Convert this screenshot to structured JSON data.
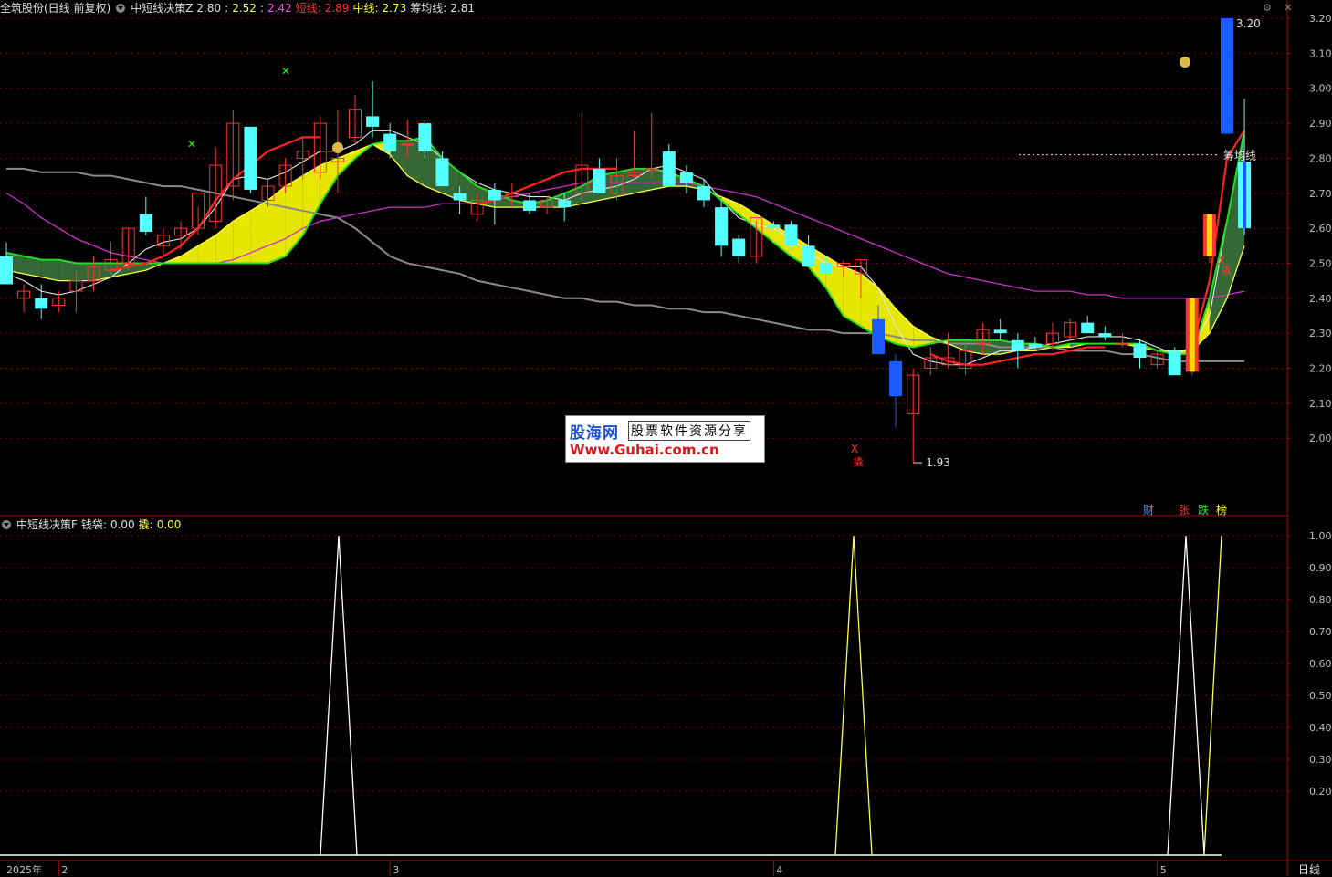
{
  "header": {
    "stock": "全筑股份(日线 前复权)",
    "indicator": "中短线决策Z",
    "v1": "2.80",
    "v2": "2.52",
    "v3": "2.42",
    "short_label": "短线:",
    "short_val": "2.89",
    "mid_label": "中线:",
    "mid_val": "2.73",
    "cost_label": "筹均线:",
    "cost_val": "2.81"
  },
  "sub_header": {
    "indicator": "中短线决策F",
    "bag_label": "钱袋:",
    "bag_val": "0.00",
    "sell_label": "撬:",
    "sell_val": "0.00"
  },
  "annotations": {
    "high": "3.20",
    "low": "1.93",
    "cost_line": "筹均线",
    "cai": "财",
    "zhang": "张",
    "die": "跌",
    "bang": "榜",
    "qiao": "撬",
    "x_mark": "X"
  },
  "period_label": "日线",
  "watermark": {
    "brand": "股海网",
    "slogan": "股票软件资源分享",
    "url": "Www.Guhai.com.cn"
  },
  "colors": {
    "up": "#ff3333",
    "down": "#54ffff",
    "grid": "#7a0000",
    "axis": "#b00000"
  },
  "chart_data": [
    {
      "type": "candlestick",
      "ylim": [
        1.9,
        3.22
      ],
      "yticks": [
        "3.20",
        "3.10",
        "3.00",
        "2.90",
        "2.80",
        "2.70",
        "2.60",
        "2.50",
        "2.40",
        "2.30",
        "2.20",
        "2.10",
        "2.00"
      ],
      "xlabels": [
        "2025年",
        "2",
        "3",
        "4",
        "5"
      ],
      "ohlc": [
        [
          2.52,
          2.56,
          2.44,
          2.44
        ],
        [
          2.4,
          2.44,
          2.36,
          2.42
        ],
        [
          2.4,
          2.44,
          2.34,
          2.37
        ],
        [
          2.38,
          2.42,
          2.36,
          2.4
        ],
        [
          2.42,
          2.48,
          2.36,
          2.45
        ],
        [
          2.45,
          2.52,
          2.42,
          2.49
        ],
        [
          2.48,
          2.56,
          2.46,
          2.51
        ],
        [
          2.5,
          2.6,
          2.48,
          2.6
        ],
        [
          2.64,
          2.69,
          2.58,
          2.59
        ],
        [
          2.55,
          2.6,
          2.52,
          2.58
        ],
        [
          2.58,
          2.62,
          2.54,
          2.6
        ],
        [
          2.6,
          2.66,
          2.58,
          2.7
        ],
        [
          2.62,
          2.83,
          2.6,
          2.78
        ],
        [
          2.72,
          2.94,
          2.68,
          2.9
        ],
        [
          2.89,
          2.89,
          2.7,
          2.71
        ],
        [
          2.68,
          2.74,
          2.66,
          2.72
        ],
        [
          2.72,
          2.8,
          2.7,
          2.78
        ],
        [
          2.8,
          2.86,
          2.74,
          2.82
        ],
        [
          2.76,
          2.92,
          2.74,
          2.9
        ],
        [
          2.79,
          2.94,
          2.7,
          2.8
        ],
        [
          2.86,
          2.98,
          2.84,
          2.94
        ],
        [
          2.92,
          3.02,
          2.86,
          2.89
        ],
        [
          2.87,
          2.9,
          2.8,
          2.82
        ],
        [
          2.84,
          2.91,
          2.8,
          2.84
        ],
        [
          2.9,
          2.91,
          2.8,
          2.82
        ],
        [
          2.8,
          2.82,
          2.72,
          2.72
        ],
        [
          2.7,
          2.72,
          2.64,
          2.68
        ],
        [
          2.64,
          2.7,
          2.62,
          2.68
        ],
        [
          2.71,
          2.73,
          2.61,
          2.68
        ],
        [
          2.69,
          2.73,
          2.66,
          2.7
        ],
        [
          2.68,
          2.7,
          2.64,
          2.65
        ],
        [
          2.66,
          2.69,
          2.64,
          2.68
        ],
        [
          2.68,
          2.7,
          2.62,
          2.66
        ],
        [
          2.7,
          2.93,
          2.68,
          2.78
        ],
        [
          2.77,
          2.8,
          2.7,
          2.7
        ],
        [
          2.7,
          2.8,
          2.68,
          2.75
        ],
        [
          2.75,
          2.88,
          2.74,
          2.76
        ],
        [
          2.77,
          2.93,
          2.74,
          2.77
        ],
        [
          2.82,
          2.84,
          2.74,
          2.72
        ],
        [
          2.76,
          2.78,
          2.7,
          2.73
        ],
        [
          2.72,
          2.74,
          2.66,
          2.68
        ],
        [
          2.66,
          2.68,
          2.52,
          2.55
        ],
        [
          2.57,
          2.58,
          2.5,
          2.52
        ],
        [
          2.52,
          2.62,
          2.5,
          2.63
        ],
        [
          2.61,
          2.62,
          2.56,
          2.6
        ],
        [
          2.61,
          2.62,
          2.54,
          2.55
        ],
        [
          2.55,
          2.58,
          2.52,
          2.49
        ],
        [
          2.5,
          2.52,
          2.47,
          2.47
        ],
        [
          2.49,
          2.51,
          2.46,
          2.5
        ],
        [
          2.47,
          2.51,
          2.4,
          2.51
        ],
        [
          2.34,
          2.38,
          2.24,
          2.24
        ],
        [
          2.22,
          2.24,
          2.03,
          2.12
        ],
        [
          2.07,
          2.2,
          1.93,
          2.18
        ],
        [
          2.2,
          2.26,
          2.18,
          2.23
        ],
        [
          2.21,
          2.3,
          2.2,
          2.23
        ],
        [
          2.2,
          2.28,
          2.18,
          2.25
        ],
        [
          2.27,
          2.33,
          2.24,
          2.31
        ],
        [
          2.31,
          2.34,
          2.28,
          2.3
        ],
        [
          2.28,
          2.3,
          2.2,
          2.25
        ],
        [
          2.27,
          2.29,
          2.25,
          2.26
        ],
        [
          2.27,
          2.33,
          2.25,
          2.3
        ],
        [
          2.29,
          2.34,
          2.28,
          2.33
        ],
        [
          2.33,
          2.35,
          2.3,
          2.3
        ],
        [
          2.3,
          2.32,
          2.28,
          2.29
        ],
        [
          2.27,
          2.3,
          2.26,
          2.27
        ],
        [
          2.27,
          2.28,
          2.2,
          2.23
        ],
        [
          2.21,
          2.25,
          2.2,
          2.24
        ],
        [
          2.25,
          2.26,
          2.18,
          2.18
        ],
        [
          2.19,
          2.4,
          2.18,
          2.4
        ],
        [
          2.52,
          2.64,
          2.5,
          2.64
        ],
        [
          2.87,
          3.2,
          2.87,
          3.2
        ],
        [
          2.79,
          2.97,
          2.58,
          2.6
        ]
      ],
      "lines": {
        "gray": [
          2.77,
          2.77,
          2.76,
          2.76,
          2.76,
          2.75,
          2.75,
          2.74,
          2.73,
          2.72,
          2.72,
          2.71,
          2.7,
          2.69,
          2.68,
          2.67,
          2.66,
          2.65,
          2.64,
          2.63,
          2.6,
          2.56,
          2.52,
          2.5,
          2.49,
          2.48,
          2.47,
          2.45,
          2.44,
          2.43,
          2.42,
          2.41,
          2.4,
          2.4,
          2.39,
          2.39,
          2.38,
          2.38,
          2.37,
          2.37,
          2.36,
          2.36,
          2.35,
          2.34,
          2.33,
          2.32,
          2.31,
          2.31,
          2.3,
          2.3,
          2.3,
          2.29,
          2.28,
          2.28,
          2.27,
          2.27,
          2.27,
          2.26,
          2.26,
          2.26,
          2.26,
          2.25,
          2.25,
          2.25,
          2.24,
          2.24,
          2.23,
          2.22,
          2.22,
          2.22,
          2.22,
          2.22
        ],
        "white": [
          2.47,
          2.45,
          2.42,
          2.41,
          2.42,
          2.44,
          2.46,
          2.5,
          2.54,
          2.56,
          2.57,
          2.6,
          2.66,
          2.74,
          2.75,
          2.74,
          2.76,
          2.79,
          2.82,
          2.82,
          2.84,
          2.88,
          2.88,
          2.86,
          2.84,
          2.8,
          2.76,
          2.73,
          2.71,
          2.7,
          2.69,
          2.69,
          2.68,
          2.7,
          2.71,
          2.72,
          2.74,
          2.77,
          2.78,
          2.76,
          2.74,
          2.68,
          2.63,
          2.61,
          2.6,
          2.57,
          2.53,
          2.5,
          2.49,
          2.49,
          2.43,
          2.32,
          2.24,
          2.22,
          2.21,
          2.21,
          2.23,
          2.25,
          2.25,
          2.26,
          2.27,
          2.28,
          2.29,
          2.29,
          2.29,
          2.28,
          2.26,
          2.24,
          2.26,
          2.35,
          2.62,
          2.87
        ],
        "yellow": [
          2.48,
          2.47,
          2.46,
          2.45,
          2.45,
          2.45,
          2.46,
          2.47,
          2.48,
          2.5,
          2.52,
          2.55,
          2.58,
          2.62,
          2.65,
          2.68,
          2.72,
          2.75,
          2.78,
          2.8,
          2.82,
          2.84,
          2.81,
          2.75,
          2.72,
          2.7,
          2.68,
          2.67,
          2.66,
          2.66,
          2.66,
          2.66,
          2.66,
          2.67,
          2.68,
          2.69,
          2.7,
          2.71,
          2.72,
          2.72,
          2.71,
          2.69,
          2.67,
          2.64,
          2.61,
          2.58,
          2.55,
          2.52,
          2.49,
          2.47,
          2.43,
          2.37,
          2.32,
          2.29,
          2.27,
          2.25,
          2.24,
          2.24,
          2.25,
          2.25,
          2.26,
          2.26,
          2.27,
          2.27,
          2.27,
          2.26,
          2.25,
          2.25,
          2.25,
          2.3,
          2.4,
          2.55
        ],
        "magenta": [
          2.7,
          2.67,
          2.63,
          2.6,
          2.57,
          2.55,
          2.53,
          2.52,
          2.51,
          2.5,
          2.5,
          2.5,
          2.5,
          2.51,
          2.53,
          2.55,
          2.57,
          2.6,
          2.62,
          2.63,
          2.64,
          2.65,
          2.66,
          2.66,
          2.66,
          2.67,
          2.67,
          2.67,
          2.68,
          2.69,
          2.7,
          2.71,
          2.72,
          2.73,
          2.73,
          2.73,
          2.73,
          2.73,
          2.73,
          2.73,
          2.72,
          2.71,
          2.7,
          2.69,
          2.67,
          2.65,
          2.63,
          2.61,
          2.59,
          2.57,
          2.55,
          2.53,
          2.51,
          2.49,
          2.47,
          2.46,
          2.45,
          2.44,
          2.43,
          2.42,
          2.42,
          2.42,
          2.41,
          2.41,
          2.4,
          2.4,
          2.4,
          2.4,
          2.4,
          2.4,
          2.41,
          2.42
        ],
        "green": [
          2.53,
          2.52,
          2.51,
          2.51,
          2.5,
          2.5,
          2.5,
          2.5,
          2.5,
          2.5,
          2.5,
          2.5,
          2.5,
          2.5,
          2.5,
          2.5,
          2.52,
          2.58,
          2.67,
          2.75,
          2.8,
          2.84,
          2.85,
          2.85,
          2.86,
          2.8,
          2.76,
          2.72,
          2.7,
          2.68,
          2.67,
          2.68,
          2.7,
          2.72,
          2.75,
          2.76,
          2.77,
          2.77,
          2.76,
          2.74,
          2.72,
          2.68,
          2.64,
          2.6,
          2.56,
          2.52,
          2.49,
          2.43,
          2.35,
          2.32,
          2.29,
          2.27,
          2.26,
          2.27,
          2.28,
          2.28,
          2.28,
          2.28,
          2.27,
          2.27,
          2.26,
          2.27,
          2.27,
          2.27,
          2.27,
          2.27,
          2.25,
          2.24,
          2.24,
          2.4,
          2.62,
          2.88
        ],
        "red": [
          null,
          null,
          null,
          null,
          null,
          null,
          2.48,
          2.49,
          2.5,
          2.52,
          2.55,
          2.6,
          2.68,
          2.74,
          2.78,
          2.82,
          2.84,
          2.86,
          2.86,
          null,
          null,
          null,
          null,
          null,
          null,
          null,
          null,
          2.67,
          2.68,
          2.7,
          2.72,
          2.74,
          2.76,
          2.77,
          2.77,
          2.77,
          null,
          null,
          null,
          null,
          null,
          null,
          null,
          null,
          null,
          null,
          null,
          null,
          null,
          null,
          null,
          null,
          null,
          2.24,
          2.22,
          2.21,
          2.21,
          2.22,
          2.23,
          2.24,
          2.24,
          2.25,
          2.26,
          2.26,
          null,
          null,
          null,
          null,
          2.26,
          2.45,
          2.8,
          2.88
        ]
      }
    },
    {
      "type": "line",
      "ylim": [
        0,
        1.05
      ],
      "yticks": [
        "1.00",
        "0.90",
        "0.80",
        "0.70",
        "0.60",
        "0.50",
        "0.40",
        "0.30",
        "0.20"
      ],
      "series": [
        {
          "name": "钱袋",
          "color": "#ffffff",
          "x": [
            17,
            18,
            19,
            69,
            70,
            71
          ],
          "y": [
            0,
            1,
            0,
            0,
            1,
            0
          ]
        },
        {
          "name": "撬",
          "color": "#ffff44",
          "x": [
            45,
            46,
            47,
            70,
            71
          ],
          "y": [
            0,
            1,
            0,
            0,
            1
          ]
        }
      ]
    }
  ]
}
